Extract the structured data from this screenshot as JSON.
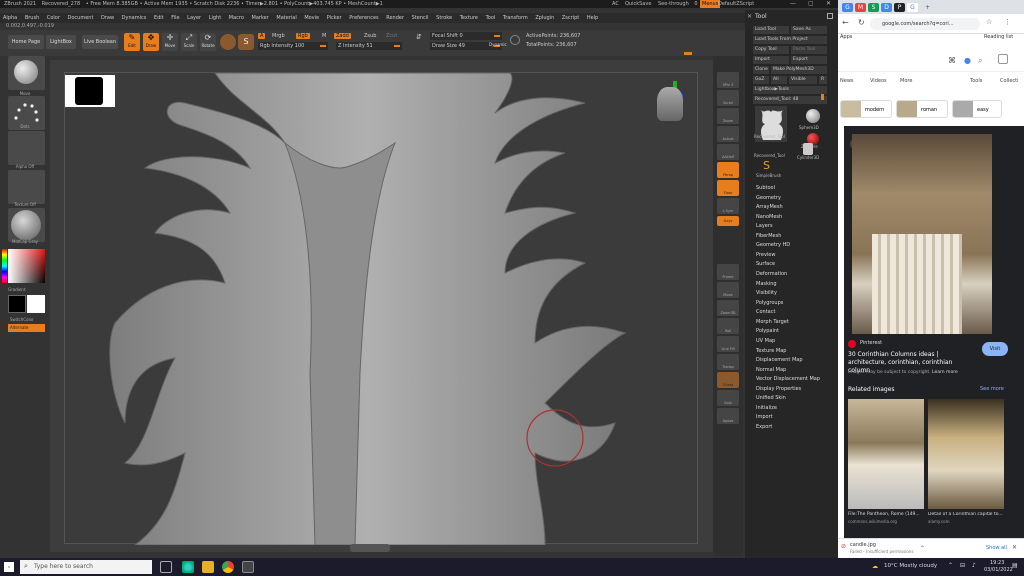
{
  "zbrush": {
    "title_segments": [
      "ZBrush 2021",
      "Recovered_278",
      "• Free Mem 8.385GB • Active Mem 1935 • Scratch Disk 2236 • Timer▶2.801 • PolyCount▶403.745 KP • MeshCount▶1"
    ],
    "title_right": {
      "ac": "AC",
      "quicksave": "QuickSave",
      "seethrough": "See-through",
      "seethrough_value": "0",
      "menus": "Menus",
      "script": "DefaultZScript"
    },
    "menu": [
      "Alpha",
      "Brush",
      "Color",
      "Document",
      "Draw",
      "Dynamics",
      "Edit",
      "File",
      "Layer",
      "Light",
      "Macro",
      "Marker",
      "Material",
      "Movie",
      "Picker",
      "Preferences",
      "Render",
      "Stencil",
      "Stroke",
      "Texture",
      "Tool",
      "Transform",
      "Zplugin",
      "Zscript",
      "Help"
    ],
    "coords": "0.002,0.497,-0.019",
    "toolbar": {
      "home": "Home Page",
      "lightbox": "LightBox",
      "livebool": "Live Boolean",
      "tools": [
        {
          "label": "Edit",
          "glyph": "✎",
          "active": true
        },
        {
          "label": "Draw",
          "glyph": "✥",
          "active": true
        },
        {
          "label": "Move",
          "glyph": "✛",
          "active": false
        },
        {
          "label": "Scale",
          "glyph": "⤢",
          "active": false
        },
        {
          "label": "Rotate",
          "glyph": "⟳",
          "active": false
        }
      ],
      "a_label": "A",
      "mrgb": "Mrgb",
      "rgb": "Rgb",
      "m": "M",
      "zadd": "Zadd",
      "zsub": "Zsub",
      "zcut": "Zcut",
      "rgb_intensity_label": "Rgb Intensity",
      "rgb_intensity": "100",
      "z_intensity_label": "Z Intensity",
      "z_intensity": "51",
      "focal_shift_label": "Focal Shift",
      "focal_shift": "0",
      "draw_size_label": "Draw Size",
      "draw_size": "49",
      "dynamic": "Dynamic",
      "active_points_label": "ActivePoints:",
      "active_points": "236,607",
      "total_points_label": "TotalPoints:",
      "total_points": "236,607"
    },
    "left_palette": {
      "move": "Move",
      "dots": "Dots",
      "alpha_off": "Alpha Off",
      "texture_off": "Texture Off",
      "material": "MatCap Gray",
      "gradient": "Gradient",
      "switch_color": "SwitchColor",
      "alternate": "Alternate"
    },
    "shelf": [
      "SPix 3",
      "Scroll",
      "Zoom",
      "Actual",
      "AAHalf",
      "Persp",
      "Floor",
      "L.Sym",
      "Gxyz",
      "Frame",
      "Move",
      "Zoom3D",
      "Rot",
      "Line Fill PolyF",
      "Transp",
      "Ghost",
      "Solo",
      "Xpose"
    ],
    "tool_panel": {
      "title": "Tool",
      "row1": [
        "Load Tool",
        "Save As"
      ],
      "row2": "Load Tools From Project",
      "row3": [
        "Copy Tool",
        "Paste Tool"
      ],
      "row4": [
        "Import",
        "Export"
      ],
      "row5": [
        "Clone",
        "Make PolyMesh3D"
      ],
      "row6": [
        "GoZ",
        "All",
        "Visible",
        "R"
      ],
      "row7": "Lightbox▶Tools",
      "current_tool_label": "Recovered_Tool:",
      "current_tool_value": "48",
      "thumbs": [
        "Recovered_Tool",
        "Sphere3D",
        "Recovered_Tool",
        "ZSphere",
        "SimpleBrush",
        "Cylinder3D"
      ],
      "list": [
        "Subtool",
        "Geometry",
        "ArrayMesh",
        "NanoMesh",
        "Layers",
        "FiberMesh",
        "Geometry HD",
        "Preview",
        "Surface",
        "Deformation",
        "Masking",
        "Visibility",
        "Polygroups",
        "Contact",
        "Morph Target",
        "Polypaint",
        "UV Map",
        "Texture Map",
        "Displacement Map",
        "Normal Map",
        "Vector Displacement Map",
        "Display Properties",
        "Unified Skin",
        "Initialize",
        "Import",
        "Export"
      ]
    }
  },
  "chrome": {
    "url": "google.com/search?q=cori...",
    "reading_list": "Reading list",
    "apps": "Apps",
    "search_tabs": [
      "News",
      "Videos",
      "More"
    ],
    "tools": "Tools",
    "collections": "Collecti",
    "chips": [
      "modern",
      "roman",
      "easy"
    ],
    "source": "Pinterest",
    "result_title": "30 Corinthian Columns ideas | architecture, corinthian, corinthian column",
    "copyright": "Images may be subject to copyright.",
    "learn_more": "Learn more",
    "visit": "Visit",
    "related": "Related images",
    "see_more": "See more",
    "related_items": [
      {
        "title": "File:The Pantheon, Rome (149...",
        "source": "commons.wikimedia.org"
      },
      {
        "title": "Detail of a Corinthian capital to...",
        "source": "alamy.com"
      }
    ],
    "download_name": "candle.jpg",
    "download_status": "Failed – Insufficient permissions",
    "show_all": "Show all"
  },
  "taskbar": {
    "search_placeholder": "Type here to search",
    "weather": "10°C  Mostly cloudy",
    "time": "19:23",
    "date": "03/01/2022"
  }
}
